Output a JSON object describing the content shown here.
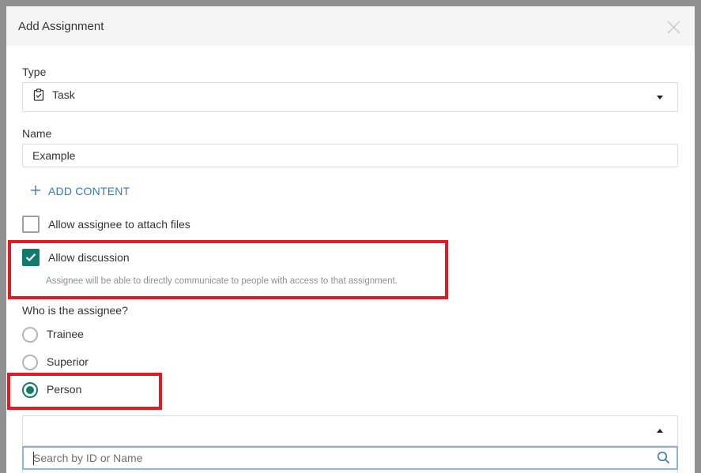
{
  "dialog": {
    "title": "Add Assignment"
  },
  "type_field": {
    "label": "Type",
    "value": "Task",
    "icon": "task-clipboard-icon"
  },
  "name_field": {
    "label": "Name",
    "value": "Example"
  },
  "add_content": {
    "label": "ADD CONTENT"
  },
  "options": {
    "attach_files": {
      "label": "Allow assignee to attach files",
      "checked": false
    },
    "discussion": {
      "label": "Allow discussion",
      "checked": true,
      "hint": "Assignee will be able to directly communicate to people with access to that assignment."
    }
  },
  "assignee": {
    "question": "Who is the assignee?",
    "choices": [
      {
        "label": "Trainee",
        "selected": false
      },
      {
        "label": "Superior",
        "selected": false
      },
      {
        "label": "Person",
        "selected": true
      }
    ]
  },
  "person_select": {
    "value": "",
    "search_placeholder": "Search by ID or Name"
  },
  "colors": {
    "accent": "#0f7b6c",
    "link": "#3a7ab8",
    "highlight": "#e01b24"
  }
}
